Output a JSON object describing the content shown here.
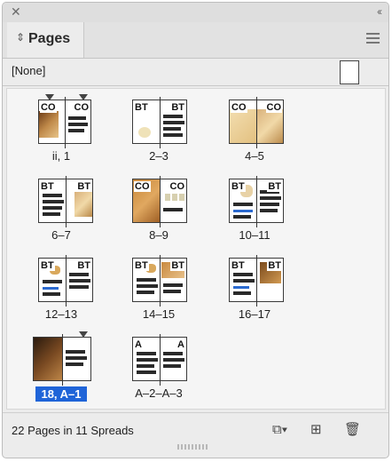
{
  "window": {
    "close_glyph": "✕",
    "collapse_glyph": "‹‹"
  },
  "tab": {
    "icon": "sort-arrows-icon",
    "label": "Pages"
  },
  "master": {
    "label": "[None]"
  },
  "spreads": [
    {
      "label": "ii, 1",
      "marks": [
        "CO",
        "CO"
      ]
    },
    {
      "label": "2–3",
      "marks": [
        "BT",
        "BT"
      ]
    },
    {
      "label": "4–5",
      "marks": [
        "CO",
        "CO"
      ]
    },
    {
      "label": "6–7",
      "marks": [
        "BT",
        "BT"
      ]
    },
    {
      "label": "8–9",
      "marks": [
        "CO",
        "CO"
      ]
    },
    {
      "label": "10–11",
      "marks": [
        "BT",
        "BT"
      ]
    },
    {
      "label": "12–13",
      "marks": [
        "BT",
        "BT"
      ]
    },
    {
      "label": "14–15",
      "marks": [
        "BT",
        "BT"
      ]
    },
    {
      "label": "16–17",
      "marks": [
        "BT",
        "BT"
      ]
    },
    {
      "label": "18, A–1",
      "marks": [
        "",
        ""
      ],
      "selected": true
    },
    {
      "label": "A–2–A–3",
      "marks": [
        "A",
        "A"
      ]
    }
  ],
  "status": {
    "text": "22 Pages in 11 Spreads"
  },
  "footer_icons": [
    "edit-page-size-icon",
    "new-page-icon",
    "trash-icon"
  ]
}
